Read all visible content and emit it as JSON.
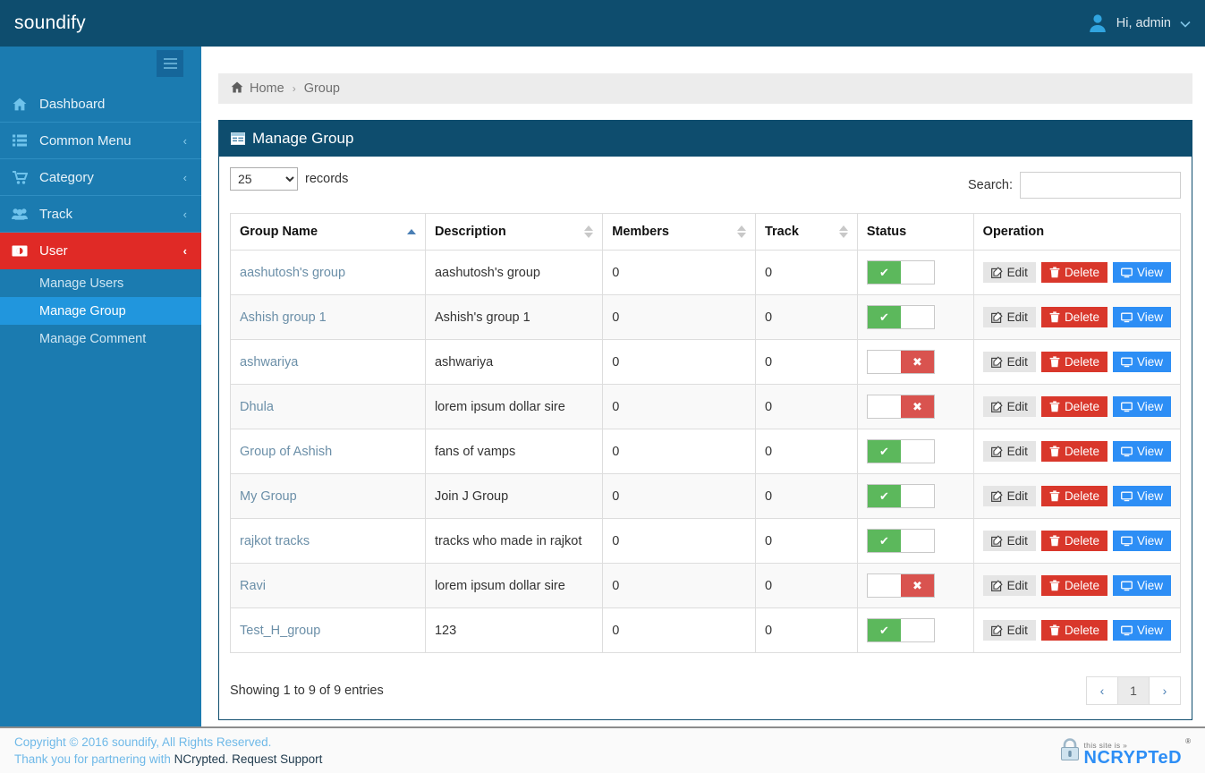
{
  "topbar": {
    "brand": "soundify",
    "user_greeting": "Hi, admin",
    "avatar_icon": "user-avatar-icon",
    "caret_icon": "chevron-down-icon"
  },
  "sidebar": {
    "toggle_icon": "hamburger-menu-icon",
    "items": [
      {
        "label": "Dashboard",
        "icon": "home-icon",
        "caret": "",
        "state": "normal"
      },
      {
        "label": "Common Menu",
        "icon": "list-icon",
        "caret": "‹",
        "state": "normal"
      },
      {
        "label": "Category",
        "icon": "cart-icon",
        "caret": "‹",
        "state": "normal"
      },
      {
        "label": "Track",
        "icon": "users-icon",
        "caret": "‹",
        "state": "normal"
      },
      {
        "label": "User",
        "icon": "id-badge-icon",
        "caret": "‹",
        "state": "active"
      }
    ],
    "subitems": [
      {
        "label": "Manage Users",
        "selected": false
      },
      {
        "label": "Manage Group",
        "selected": true
      },
      {
        "label": "Manage Comment",
        "selected": false
      }
    ]
  },
  "breadcrumb": {
    "home_icon": "home-icon",
    "home": "Home",
    "separator": "›",
    "current": "Group"
  },
  "panel": {
    "title": "Manage Group",
    "title_icon": "table-icon"
  },
  "controls": {
    "length_value": "25",
    "length_options": [
      "25"
    ],
    "length_suffix": "records",
    "search_label": "Search:",
    "search_value": "",
    "search_placeholder": ""
  },
  "table": {
    "columns": [
      {
        "label": "Group Name",
        "sort": "asc"
      },
      {
        "label": "Description",
        "sort": "none"
      },
      {
        "label": "Members",
        "sort": "none"
      },
      {
        "label": "Track",
        "sort": "none"
      },
      {
        "label": "Status",
        "sort": ""
      },
      {
        "label": "Operation",
        "sort": ""
      }
    ],
    "rows": [
      {
        "name": "aashutosh's group",
        "description": "aashutosh's group",
        "members": "0",
        "track": "0",
        "status": "on"
      },
      {
        "name": "Ashish group 1",
        "description": "Ashish's group 1",
        "members": "0",
        "track": "0",
        "status": "on"
      },
      {
        "name": "ashwariya",
        "description": "ashwariya",
        "members": "0",
        "track": "0",
        "status": "off"
      },
      {
        "name": "Dhula",
        "description": "lorem ipsum dollar sire",
        "members": "0",
        "track": "0",
        "status": "off"
      },
      {
        "name": "Group of Ashish",
        "description": "fans of vamps",
        "members": "0",
        "track": "0",
        "status": "on"
      },
      {
        "name": "My Group",
        "description": "Join J Group",
        "members": "0",
        "track": "0",
        "status": "on"
      },
      {
        "name": "rajkot tracks",
        "description": "tracks who made in rajkot",
        "members": "0",
        "track": "0",
        "status": "on"
      },
      {
        "name": "Ravi",
        "description": "lorem ipsum dollar sire",
        "members": "0",
        "track": "0",
        "status": "off"
      },
      {
        "name": "Test_H_group",
        "description": "123",
        "members": "0",
        "track": "0",
        "status": "on"
      }
    ],
    "actions": {
      "edit_label": "Edit",
      "delete_label": "Delete",
      "view_label": "View",
      "edit_icon": "pencil-square-icon",
      "delete_icon": "trash-icon",
      "view_icon": "monitor-icon"
    },
    "status_on_icon": "check-icon",
    "status_off_icon": "cross-icon"
  },
  "footer_table": {
    "info": "Showing 1 to 9 of 9 entries",
    "pager": {
      "prev": "‹",
      "pages": [
        "1"
      ],
      "next": "›",
      "current": "1"
    }
  },
  "footer": {
    "copyright": "Copyright © 2016 soundify, All Rights Reserved.",
    "partner_prefix": "Thank you for partnering with ",
    "partner_highlight": "NCrypted. Request Support",
    "logo": {
      "lock_icon": "padlock-icon",
      "tagline": "this site is »",
      "name": "NCRYPTeD",
      "registered": "®"
    }
  },
  "colors": {
    "brand_dark": "#0e4d6e",
    "sidebar": "#1b7bb0",
    "active_red": "#e02a26",
    "selected_blue": "#2196dd",
    "status_on": "#5cb85c",
    "status_off": "#d9534f",
    "btn_delete": "#d9372b",
    "btn_view": "#2d8ef5"
  }
}
